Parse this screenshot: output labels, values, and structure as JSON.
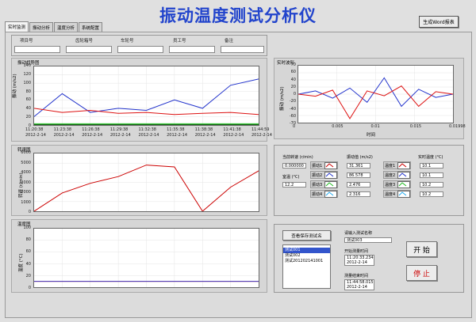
{
  "app": {
    "title": "振动温度测试分析仪",
    "report_button": "生成Word报表"
  },
  "tabs": [
    "实时监测",
    "振动分析",
    "温度分析",
    "系统配置"
  ],
  "fields": [
    {
      "label": "项目号",
      "value": ""
    },
    {
      "label": "齿轮箱号",
      "value": ""
    },
    {
      "label": "车轮号",
      "value": ""
    },
    {
      "label": "员工号",
      "value": ""
    },
    {
      "label": "备注",
      "value": ""
    }
  ],
  "vibration_chart": {
    "title": "振动趋势图",
    "ylabel": "振动 (m/s2)",
    "y_ticks": [
      "140",
      "120",
      "100",
      "80",
      "60",
      "40",
      "20",
      "0"
    ],
    "x_ticks_time": [
      "11:20:38",
      "11:23:38",
      "11:26:38",
      "11:29:38",
      "11:32:38",
      "11:35:38",
      "11:38:38",
      "11:41:38",
      "11:44:59"
    ],
    "x_ticks_date": [
      "2012-2-14",
      "2012-2-14",
      "2012-2-14",
      "2012-2-14",
      "2012-2-14",
      "2012-2-14",
      "2012-2-14",
      "2012-2-14",
      "2012-2-14"
    ]
  },
  "speed_chart": {
    "title": "转速图",
    "ylabel": "转速 (r/min)",
    "y_ticks": [
      "6000",
      "5000",
      "4000",
      "3000",
      "2000",
      "1000",
      "0"
    ]
  },
  "temp_chart": {
    "title": "温度图",
    "ylabel": "温度 (°C)",
    "y_ticks": [
      "100",
      "80",
      "60",
      "40",
      "20",
      "0"
    ]
  },
  "waveform_chart": {
    "title": "实时波形",
    "ylabel": "振动 (m/s2)",
    "xlabel": "时间",
    "y_ticks": [
      "70",
      "60",
      "40",
      "20",
      "0",
      "-20",
      "-40",
      "-60",
      "-70"
    ],
    "x_ticks": [
      "0",
      "0.005",
      "0.01",
      "0.015",
      "0.01998"
    ]
  },
  "status": {
    "speed_label": "当前转速 (r/min)",
    "speed_value": "0.000000",
    "room_temp_label": "室温 (°C)",
    "room_temp_value": "12.2",
    "vib_header": "振动值 (m/s2)",
    "temp_header": "实时温度 (°C)",
    "vib_channels": [
      "振动1",
      "振动2",
      "振动3",
      "振动4"
    ],
    "vib_values": [
      "31.361",
      "86.578",
      "2.476",
      "2.316"
    ],
    "temp_channels": [
      "温度1",
      "温度2",
      "温度3",
      "温度4"
    ],
    "temp_values": [
      "10.1",
      "10.1",
      "10.2",
      "10.2"
    ]
  },
  "test_panel": {
    "query_button": "查看保存测试名",
    "list_items": [
      "测试001",
      "测试002",
      "测试201202141001"
    ],
    "name_label": "请输入测试名称",
    "name_value": "测试003",
    "start_label": "开始测量时间",
    "start_time": "11:20:33.234",
    "start_date": "2012-2-14",
    "end_label": "测量结束时间",
    "end_time": "11:44:58.015",
    "end_date": "2012-2-14",
    "start_button": "开 始",
    "stop_button": "停 止"
  },
  "chart_data": [
    {
      "type": "line",
      "title": "振动趋势图",
      "ylabel": "振动 (m/s2)",
      "ylim": [
        0,
        140
      ],
      "x": [
        "11:20:38",
        "11:23:38",
        "11:26:38",
        "11:29:38",
        "11:32:38",
        "11:35:38",
        "11:38:38",
        "11:41:38",
        "11:44:59"
      ],
      "series": [
        {
          "name": "振动1",
          "color": "#2233cc",
          "values": [
            20,
            75,
            30,
            40,
            35,
            60,
            40,
            95,
            110
          ]
        },
        {
          "name": "振动2",
          "color": "#dd1111",
          "values": [
            40,
            30,
            35,
            28,
            30,
            25,
            28,
            30,
            25
          ]
        },
        {
          "name": "振动3",
          "color": "#22bb22",
          "values": [
            3,
            3,
            3,
            3,
            3,
            3,
            3,
            3,
            3
          ]
        },
        {
          "name": "振动4",
          "color": "#116611",
          "values": [
            1,
            1,
            1,
            1,
            1,
            1,
            1,
            1,
            1
          ]
        }
      ]
    },
    {
      "type": "line",
      "title": "转速图",
      "ylabel": "转速 (r/min)",
      "ylim": [
        0,
        6000
      ],
      "x": [
        "11:20:38",
        "11:23:38",
        "11:26:38",
        "11:29:38",
        "11:32:38",
        "11:35:38",
        "11:38:38",
        "11:41:38",
        "11:44:59"
      ],
      "series": [
        {
          "name": "转速",
          "color": "#cc0000",
          "values": [
            0,
            1900,
            2900,
            3600,
            4800,
            4600,
            0,
            2500,
            4200
          ]
        }
      ]
    },
    {
      "type": "line",
      "title": "温度图",
      "ylabel": "温度 (°C)",
      "ylim": [
        0,
        100
      ],
      "series": [
        {
          "name": "温度1",
          "color": "#cc0000",
          "values": [
            10,
            10,
            10,
            10,
            10,
            10,
            10,
            10,
            10
          ]
        },
        {
          "name": "温度2",
          "color": "#4444cc",
          "values": [
            10,
            10,
            10,
            10,
            10,
            10,
            10,
            10,
            10
          ]
        }
      ]
    },
    {
      "type": "line",
      "title": "实时波形",
      "xlabel": "时间",
      "ylabel": "振动 (m/s2)",
      "xlim": [
        0,
        0.01998
      ],
      "ylim": [
        -70,
        70
      ],
      "series": [
        {
          "name": "振动1",
          "color": "#2233cc",
          "values": [
            0,
            8,
            -10,
            15,
            -20,
            40,
            -30,
            12,
            -8,
            0
          ]
        },
        {
          "name": "振动2",
          "color": "#dd1111",
          "values": [
            0,
            -5,
            10,
            -60,
            8,
            -4,
            20,
            -30,
            6,
            0
          ]
        }
      ]
    }
  ]
}
